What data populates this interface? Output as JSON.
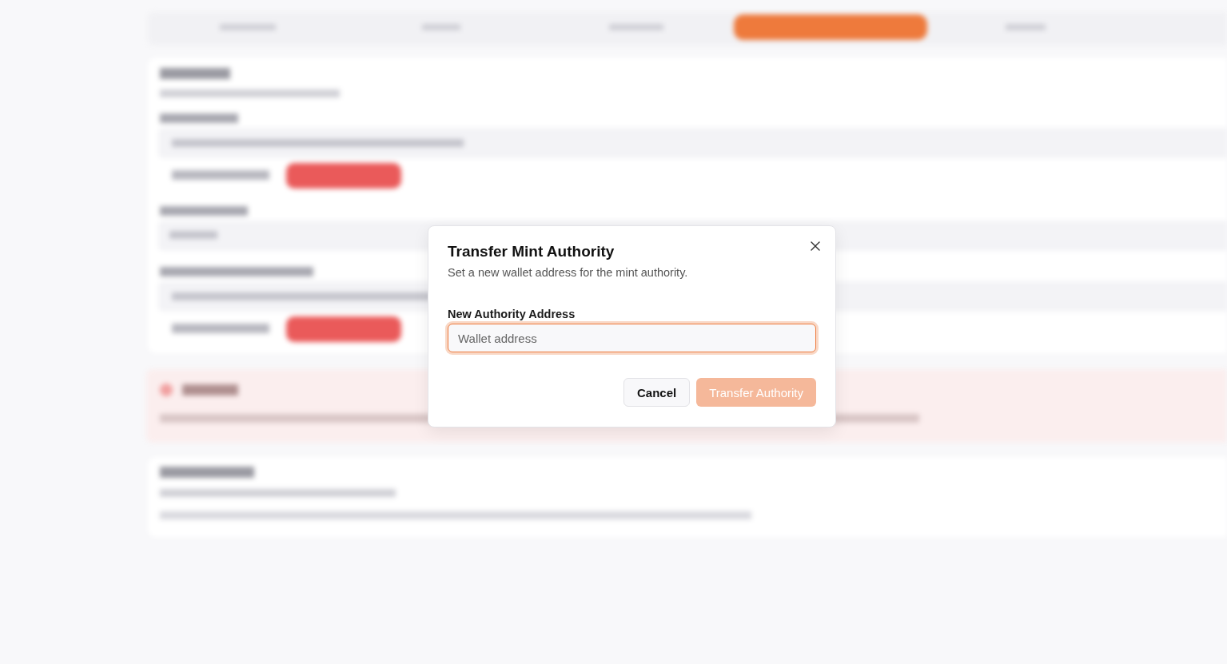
{
  "dialog": {
    "title": "Transfer Mint Authority",
    "description": "Set a new wallet address for the mint authority.",
    "field": {
      "label": "New Authority Address",
      "placeholder": "Wallet address",
      "focused": true
    },
    "buttons": [
      {
        "kind": "secondary",
        "label": "Cancel",
        "disabled": false
      },
      {
        "kind": "primary",
        "label": "Transfer Authority",
        "disabled": true
      }
    ]
  }
}
